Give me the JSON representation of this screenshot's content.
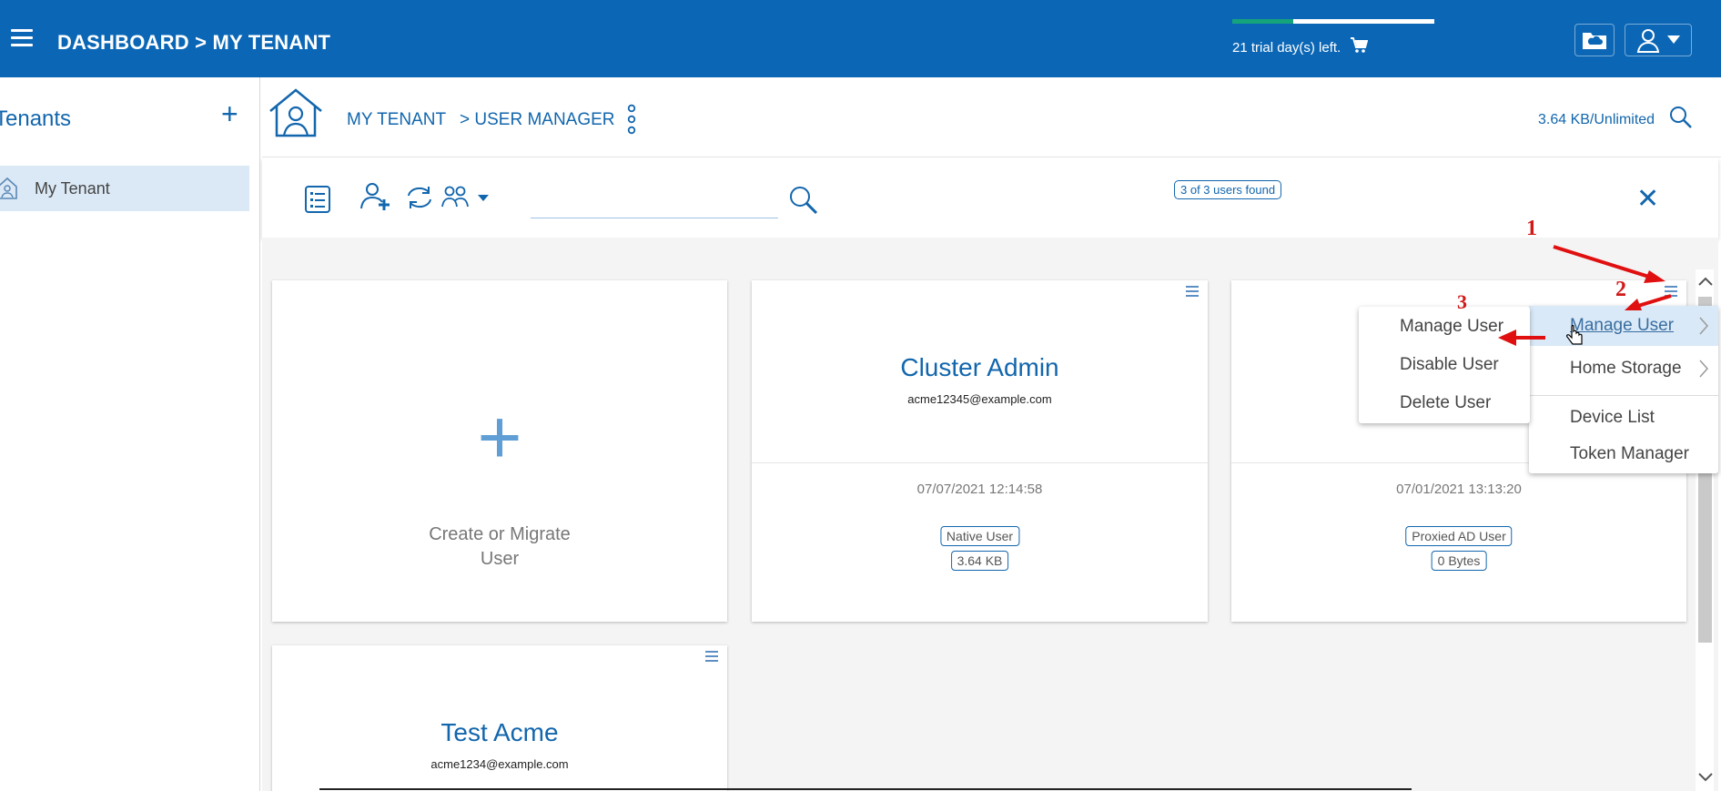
{
  "header": {
    "title": "DASHBOARD > MY TENANT",
    "trial_text": "21 trial day(s) left.",
    "trial_progress": 0.3,
    "icons": [
      "menu-icon",
      "cart-icon",
      "cloud-folder-icon",
      "user-account-icon",
      "caret-down-icon"
    ]
  },
  "sidebar": {
    "title": "Tenants",
    "add_label": "+",
    "items": [
      {
        "label": "My Tenant",
        "selected": true
      }
    ]
  },
  "breadcrumb": {
    "crumb1": "MY TENANT",
    "crumb2": "> USER MANAGER",
    "storage": "3.64 KB/Unlimited"
  },
  "toolbar": {
    "search_value": "",
    "found_label": "3 of 3 users found",
    "close_label": "✕"
  },
  "cards": {
    "create": {
      "plus": "+",
      "line1": "Create or Migrate",
      "line2": "User"
    },
    "users": [
      {
        "name": "Cluster Admin",
        "email": "acme12345@example.com",
        "date": "07/07/2021 12:14:58",
        "type": "Native User",
        "size": "3.64 KB"
      },
      {
        "name": "",
        "email": "",
        "date": "07/01/2021 13:13:20",
        "type": "Proxied AD User",
        "size": "0 Bytes"
      },
      {
        "name": "Test Acme",
        "email": "acme1234@example.com"
      }
    ]
  },
  "context_menu": {
    "items": [
      {
        "label": "Manage User",
        "has_submenu": true,
        "highlighted": true
      },
      {
        "label": "Home Storage",
        "has_submenu": true
      },
      {
        "label": "Device List"
      },
      {
        "label": "Token Manager"
      }
    ]
  },
  "submenu": {
    "items": [
      {
        "label": "Manage User"
      },
      {
        "label": "Disable User"
      },
      {
        "label": "Delete User"
      }
    ]
  },
  "annotations": {
    "step1": "1",
    "step2": "2",
    "step3": "3",
    "color": "#d11a1a"
  },
  "colors": {
    "brand": "#0b67b6",
    "accent": "#1266ad",
    "trial_fill": "#14a37a"
  }
}
